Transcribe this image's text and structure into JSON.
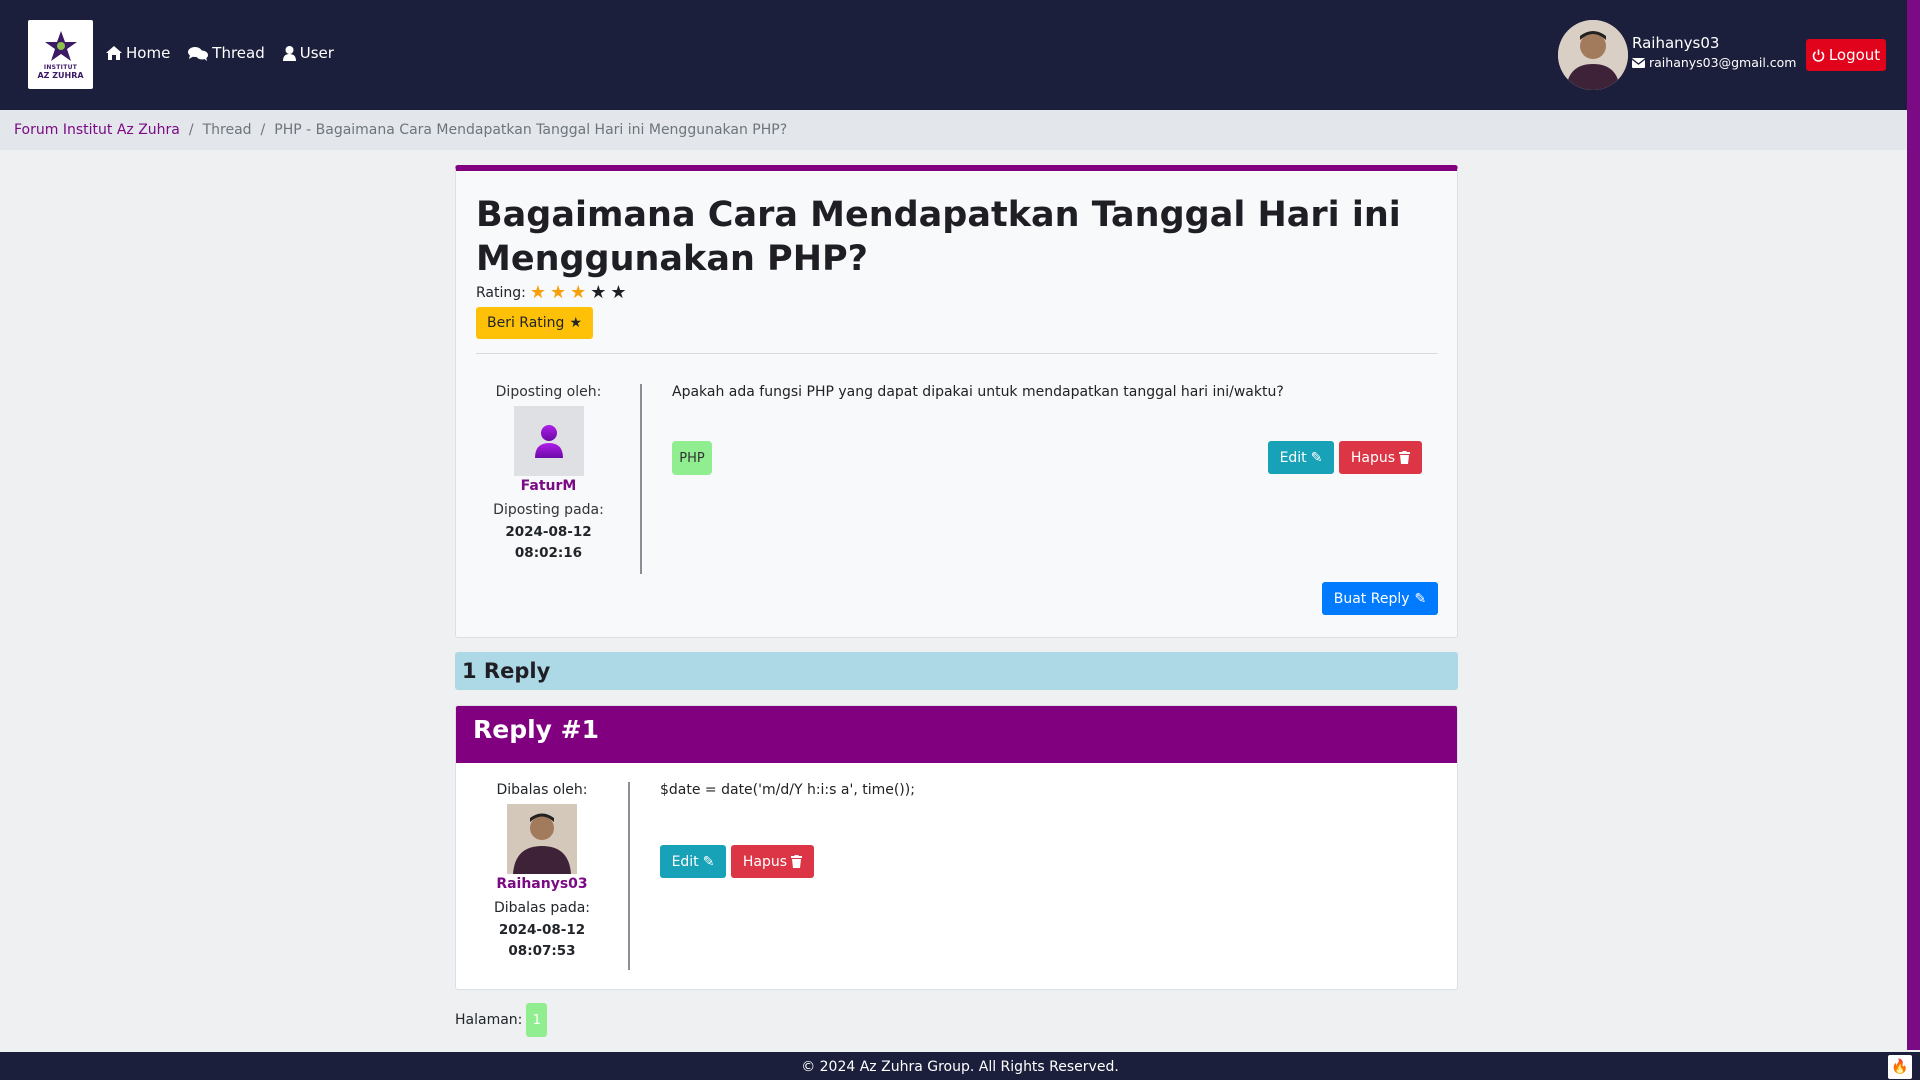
{
  "brand": {
    "logo_line1": "INSTITUT",
    "logo_line2": "AZ ZUHRA"
  },
  "nav": {
    "home": "Home",
    "thread": "Thread",
    "user": "User"
  },
  "user": {
    "name": "Raihanys03",
    "email": "raihanys03@gmail.com",
    "logout": "Logout"
  },
  "breadcrumb": {
    "root": "Forum Institut Az Zuhra",
    "section": "Thread",
    "current": "PHP - Bagaimana Cara Mendapatkan Tanggal Hari ini Menggunakan PHP?"
  },
  "thread": {
    "title": "Bagaimana Cara Mendapatkan Tanggal Hari ini Menggunakan PHP?",
    "rating_label": "Rating:",
    "rating": 3,
    "rating_max": 5,
    "rate_button": "Beri Rating",
    "posted_by_label": "Diposting oleh:",
    "author": "FaturM",
    "posted_at_label": "Diposting pada:",
    "posted_date": "2024-08-12",
    "posted_time": "08:02:16",
    "body": "Apakah ada fungsi PHP yang dapat dipakai untuk mendapatkan tanggal hari ini/waktu?",
    "tag": "PHP",
    "edit": "Edit",
    "delete": "Hapus",
    "reply_button": "Buat Reply"
  },
  "replies": {
    "count_label": "1 Reply",
    "items": [
      {
        "header": "Reply #1",
        "replied_by_label": "Dibalas oleh:",
        "author": "Raihanys03",
        "replied_at_label": "Dibalas pada:",
        "date": "2024-08-12",
        "time": "08:07:53",
        "body": "$date = date('m/d/Y h:i:s a', time());",
        "edit": "Edit",
        "delete": "Hapus"
      }
    ]
  },
  "pagination": {
    "label": "Halaman:",
    "current": "1"
  },
  "footer": {
    "text": "© 2024 Az Zuhra Group. All Rights Reserved."
  },
  "colors": {
    "navbar": "#1b1f3b",
    "accent": "#800080",
    "warning": "#ffc107",
    "info": "#17a2b8",
    "danger": "#dc3545",
    "primary": "#007bff"
  }
}
